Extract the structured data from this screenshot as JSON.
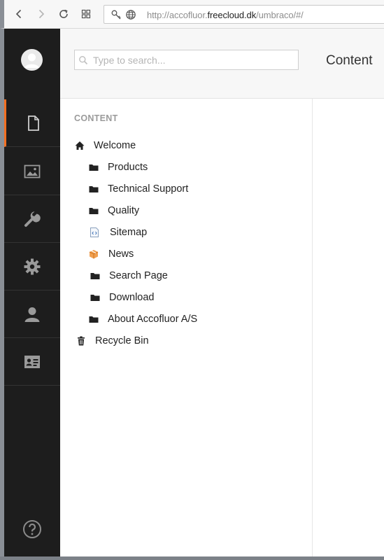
{
  "browser": {
    "url_prefix": "http://accofluor.",
    "url_domain": "freecloud.dk",
    "url_suffix": "/umbraco/#/",
    "icons": [
      "back-icon",
      "forward-icon",
      "reload-icon",
      "grid-icon",
      "key-icon",
      "globe-icon"
    ]
  },
  "sidebar": {
    "sections": [
      {
        "name": "content",
        "icon": "document-icon",
        "active": true
      },
      {
        "name": "media",
        "icon": "image-icon",
        "active": false
      },
      {
        "name": "developer",
        "icon": "wrench-icon",
        "active": false
      },
      {
        "name": "settings",
        "icon": "gear-icon",
        "active": false
      },
      {
        "name": "users",
        "icon": "user-icon",
        "active": false
      },
      {
        "name": "members",
        "icon": "id-card-icon",
        "active": false
      }
    ],
    "help_icon": "help-icon",
    "accent": "#f36f21"
  },
  "tree": {
    "search_placeholder": "Type to search...",
    "title": "CONTENT",
    "nodes": [
      {
        "label": "Welcome",
        "icon": "home-icon"
      },
      {
        "label": "Products",
        "icon": "folder-icon"
      },
      {
        "label": "Technical Support",
        "icon": "folder-icon"
      },
      {
        "label": "Quality",
        "icon": "folder-icon"
      },
      {
        "label": "Sitemap",
        "icon": "sitemap-icon"
      },
      {
        "label": "News",
        "icon": "box-icon"
      },
      {
        "label": "Search Page",
        "icon": "folder-icon"
      },
      {
        "label": "Download",
        "icon": "folder-icon"
      },
      {
        "label": "About Accofluor A/S",
        "icon": "folder-icon"
      },
      {
        "label": "Recycle Bin",
        "icon": "trash-icon"
      }
    ]
  },
  "main": {
    "title": "Content"
  }
}
